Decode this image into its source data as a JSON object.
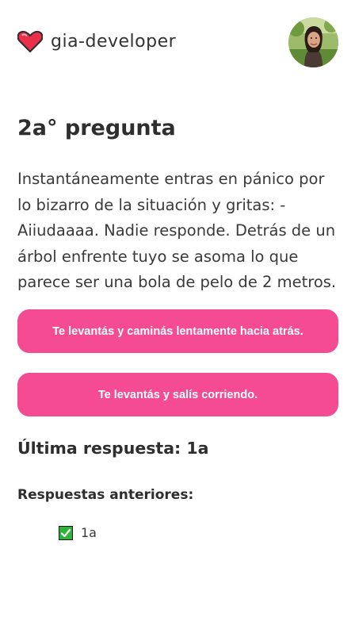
{
  "header": {
    "brand_icon": "heart-icon",
    "brand_name": "gia-developer",
    "avatar_icon": "profile-photo",
    "accent_color": "#f44b92"
  },
  "question": {
    "title": "2a° pregunta",
    "text": "Instantáneamente entras en pánico por lo bizarro de la situación y gritas: - Aiiudaaaa. Nadie responde. Detrás de un árbol enfrente tuyo se asoma lo que parece ser una bola de pelo de 2 metros."
  },
  "options": [
    {
      "label": "Te levantás y caminás lentamente hacia atrás."
    },
    {
      "label": "Te levantás y salís corriendo."
    }
  ],
  "last_answer": {
    "text": "Última respuesta: 1a"
  },
  "previous_answers": {
    "heading": "Respuestas anteriores:",
    "items": [
      {
        "icon": "check-icon",
        "label": "1a"
      }
    ]
  }
}
